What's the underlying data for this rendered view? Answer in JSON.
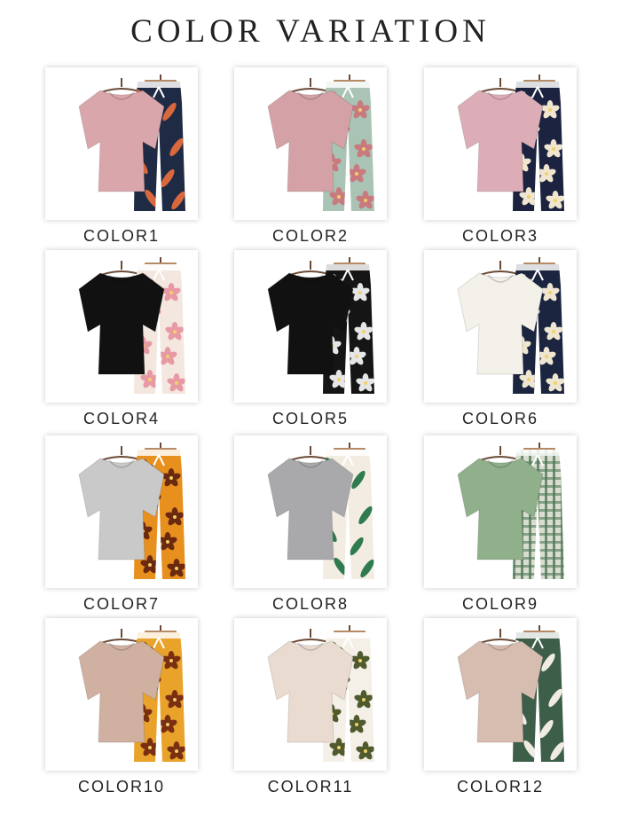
{
  "title": "COLOR VARIATION",
  "items": [
    {
      "label": "COLOR1",
      "icon": "pajama-set-icon",
      "colors": {
        "top": "#d9a6ac",
        "pants_bg": "#1f2a44",
        "pants_pattern": "#d9683c",
        "pattern": "leaves"
      }
    },
    {
      "label": "COLOR2",
      "icon": "pajama-set-icon",
      "colors": {
        "top": "#d4a2a6",
        "pants_bg": "#a9c3b4",
        "pants_pattern": "#c97a7f",
        "pattern": "floral"
      }
    },
    {
      "label": "COLOR3",
      "icon": "pajama-set-icon",
      "colors": {
        "top": "#dcadb6",
        "pants_bg": "#1c2340",
        "pants_pattern": "#f0e6cf",
        "pattern": "floral"
      }
    },
    {
      "label": "COLOR4",
      "icon": "pajama-set-icon",
      "colors": {
        "top": "#111111",
        "pants_bg": "#f3e7df",
        "pants_pattern": "#e79aa4",
        "pattern": "floral"
      }
    },
    {
      "label": "COLOR5",
      "icon": "pajama-set-icon",
      "colors": {
        "top": "#111111",
        "pants_bg": "#151515",
        "pants_pattern": "#e6e6e6",
        "pattern": "floral"
      }
    },
    {
      "label": "COLOR6",
      "icon": "pajama-set-icon",
      "colors": {
        "top": "#f4f1ea",
        "pants_bg": "#1b2540",
        "pants_pattern": "#efe6d2",
        "pattern": "floral"
      }
    },
    {
      "label": "COLOR7",
      "icon": "pajama-set-icon",
      "colors": {
        "top": "#c9c9c9",
        "pants_bg": "#e8901e",
        "pants_pattern": "#6b2a10",
        "pattern": "floral"
      }
    },
    {
      "label": "COLOR8",
      "icon": "pajama-set-icon",
      "colors": {
        "top": "#a9a9ab",
        "pants_bg": "#f3ece2",
        "pants_pattern": "#2f7a4e",
        "pattern": "leaves"
      }
    },
    {
      "label": "COLOR9",
      "icon": "pajama-set-icon",
      "colors": {
        "top": "#8fb08a",
        "pants_bg": "#d9dccf",
        "pants_pattern": "#4f7a57",
        "pattern": "plaid"
      }
    },
    {
      "label": "COLOR10",
      "icon": "pajama-set-icon",
      "colors": {
        "top": "#cfb0a1",
        "pants_bg": "#e9a22a",
        "pants_pattern": "#7a2f12",
        "pattern": "floral"
      }
    },
    {
      "label": "COLOR11",
      "icon": "pajama-set-icon",
      "colors": {
        "top": "#e9dbd0",
        "pants_bg": "#f4efe7",
        "pants_pattern": "#4f5a2d",
        "pattern": "floral"
      }
    },
    {
      "label": "COLOR12",
      "icon": "pajama-set-icon",
      "colors": {
        "top": "#d7bdb0",
        "pants_bg": "#3d5f4a",
        "pants_pattern": "#f0ece2",
        "pattern": "leaves"
      }
    }
  ]
}
